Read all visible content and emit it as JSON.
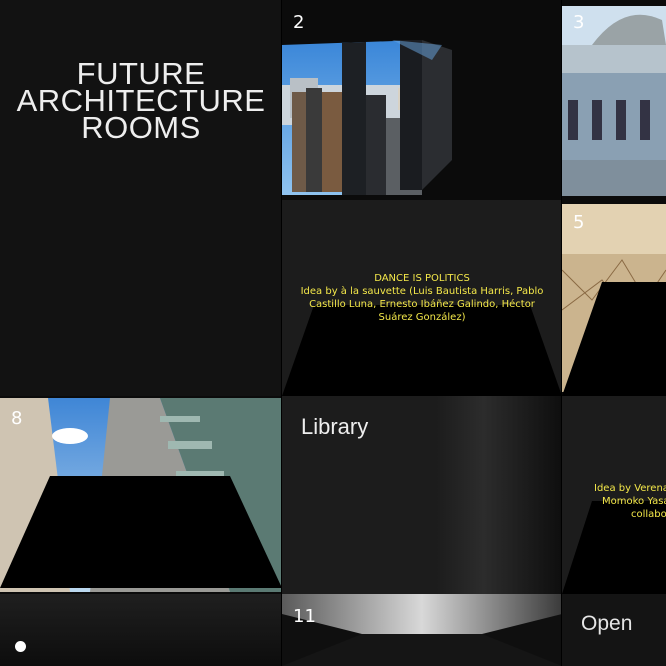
{
  "site": {
    "title_lines": [
      "FUTURE",
      "ARCHITECTURE",
      "ROOMS"
    ]
  },
  "rooms": [
    {
      "number": "2"
    },
    {
      "number": "3"
    },
    {
      "number": "5",
      "caption_title": "DANCE IS POLITICS",
      "caption_body": "Idea by à la sauvette (Luis Bautista Harris, Pablo Castillo Luna, Ernesto Ibáñez Galindo, Héctor Suárez González)"
    },
    {
      "number": "8"
    },
    {
      "number": "11"
    }
  ],
  "library": {
    "label": "Library"
  },
  "partial_room": {
    "caption_lines": [
      "Idea by Verena",
      "Momoko Yasa",
      "collabo"
    ]
  },
  "open_room": {
    "label": "Open"
  },
  "colors": {
    "caption": "#f4e84a",
    "background": "#000000",
    "panel": "#1c1c1c"
  },
  "indicator": {
    "icon": "dot-icon"
  }
}
